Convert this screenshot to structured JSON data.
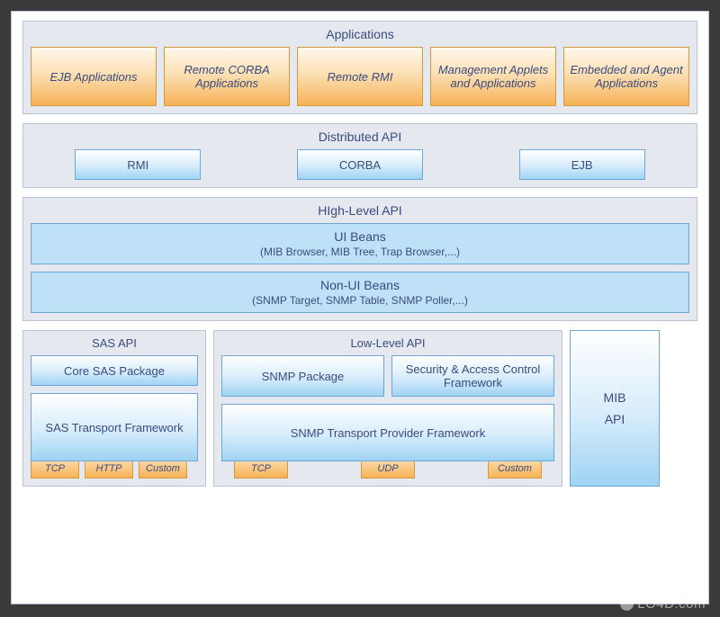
{
  "applications": {
    "title": "Applications",
    "items": [
      "EJB Applications",
      "Remote CORBA Applications",
      "Remote RMI",
      "Management Applets and Applications",
      "Embedded and Agent Applications"
    ]
  },
  "distributed": {
    "title": "Distributed API",
    "items": [
      "RMI",
      "CORBA",
      "EJB"
    ]
  },
  "highlevel": {
    "title": "HIgh-Level API",
    "ui": {
      "title": "UI Beans",
      "sub": "(MIB Browser, MIB Tree, Trap Browser,...)"
    },
    "nonui": {
      "title": "Non-UI Beans",
      "sub": "(SNMP Target, SNMP Table, SNMP Poller,...)"
    }
  },
  "sas": {
    "title": "SAS API",
    "pkg": "Core SAS Package",
    "transport": "SAS Transport Framework",
    "tabs": [
      "TCP",
      "HTTP",
      "Custom"
    ]
  },
  "low": {
    "title": "Low-Level API",
    "pkg1": "SNMP Package",
    "pkg2": "Security & Access Control Framework",
    "transport": "SNMP Transport Provider Framework",
    "tabs": [
      "TCP",
      "UDP",
      "Custom"
    ]
  },
  "mib": {
    "l1": "MIB",
    "l2": "API"
  },
  "watermark": "LO4D.com"
}
